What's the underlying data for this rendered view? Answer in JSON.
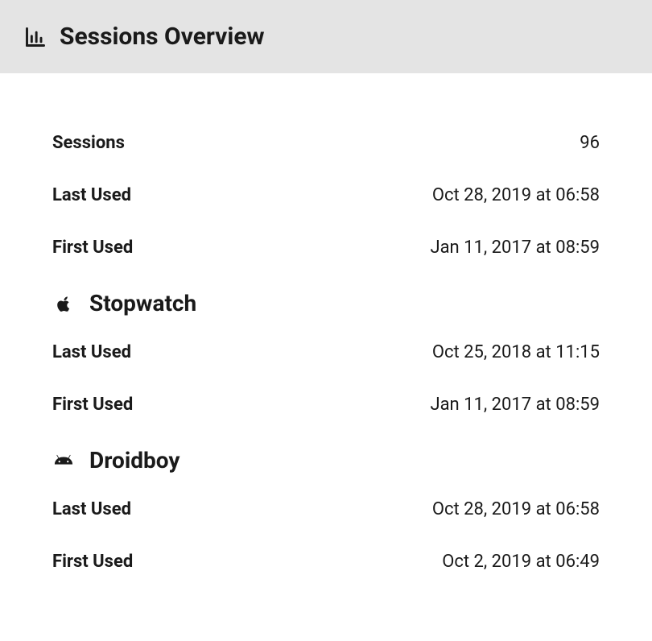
{
  "header": {
    "title": "Sessions Overview"
  },
  "summary": {
    "sessions": {
      "label": "Sessions",
      "value": "96"
    },
    "lastUsed": {
      "label": "Last Used",
      "value": "Oct 28, 2019 at 06:58"
    },
    "firstUsed": {
      "label": "First Used",
      "value": "Jan 11, 2017 at 08:59"
    }
  },
  "apps": [
    {
      "name": "Stopwatch",
      "platform": "apple",
      "lastUsed": {
        "label": "Last Used",
        "value": "Oct 25, 2018 at 11:15"
      },
      "firstUsed": {
        "label": "First Used",
        "value": "Jan 11, 2017 at 08:59"
      }
    },
    {
      "name": "Droidboy",
      "platform": "android",
      "lastUsed": {
        "label": "Last Used",
        "value": "Oct 28, 2019 at 06:58"
      },
      "firstUsed": {
        "label": "First Used",
        "value": "Oct 2, 2019 at 06:49"
      }
    }
  ]
}
